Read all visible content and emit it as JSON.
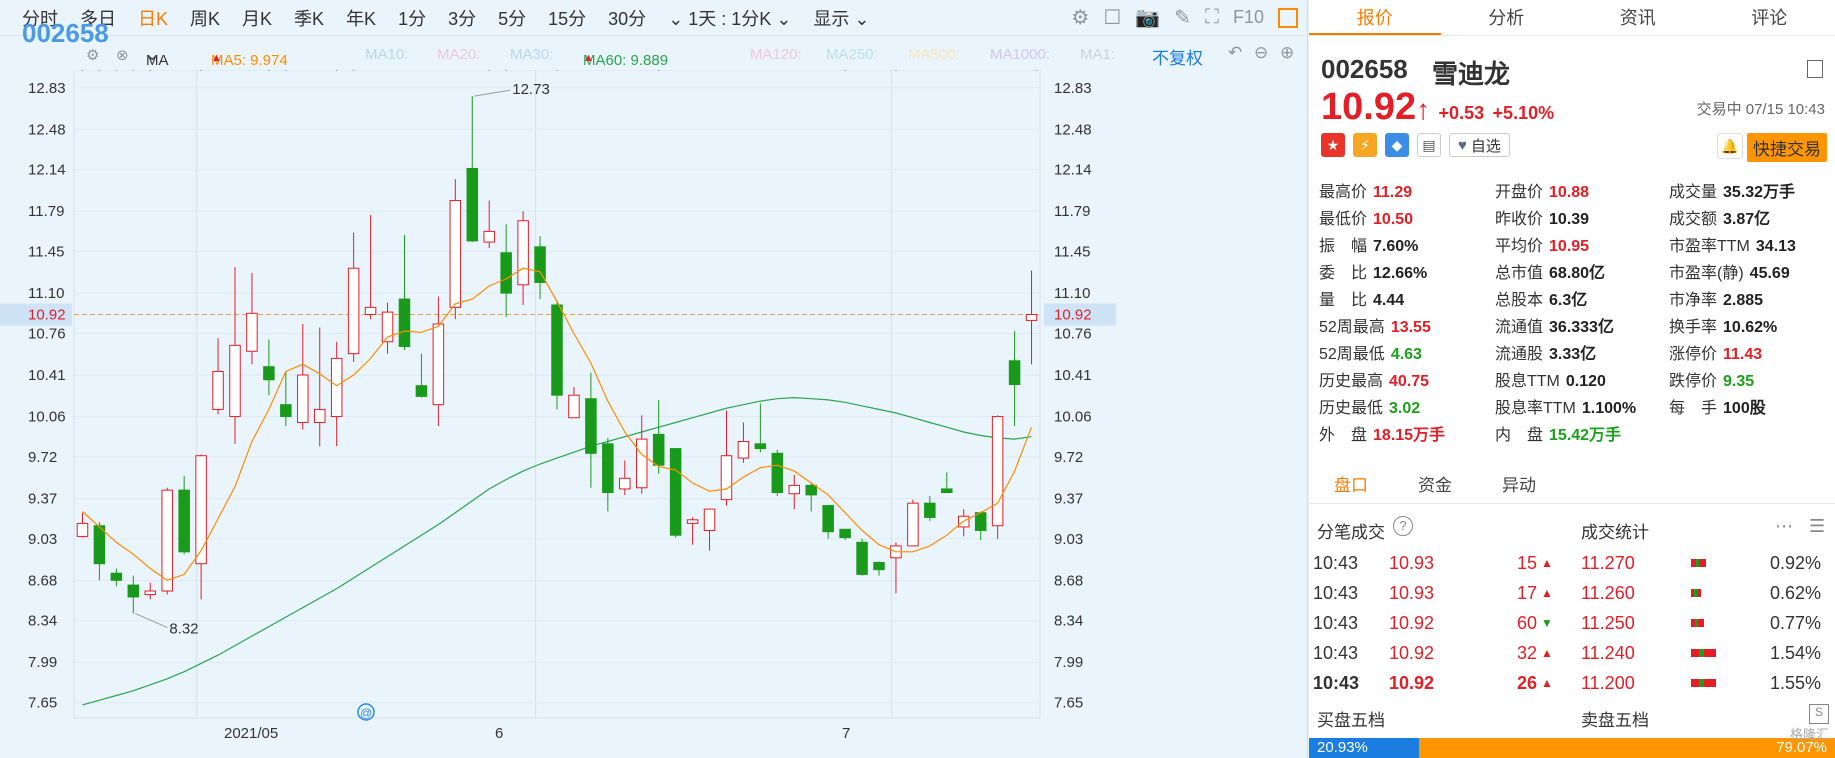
{
  "toolbar": {
    "code": "002658",
    "periods": [
      "分时",
      "多日",
      "日K",
      "周K",
      "月K",
      "季K",
      "年K",
      "1分",
      "3分",
      "5分",
      "15分",
      "30分"
    ],
    "active_period": "日K",
    "range_select": "1天 : 1分K",
    "display": "显示",
    "f10": "F10"
  },
  "ma_bar": {
    "label": "MA",
    "ma5": "MA5: 9.974",
    "ma10": "MA10:",
    "ma20": "MA20:",
    "ma30": "MA30:",
    "ma60": "MA60: 9.889",
    "ma120": "MA120:",
    "ma250": "MA250:",
    "ma500": "MA500:",
    "ma1000": "MA1000:",
    "ma1": "MA1:",
    "adjust": "不复权",
    "colors": {
      "ma5": "#ff8c00",
      "ma60": "#2aa54a",
      "faded": "#b9d7f0"
    }
  },
  "chart_data": {
    "type": "candlestick",
    "y_ticks": [
      "12.83",
      "12.48",
      "12.14",
      "11.79",
      "11.45",
      "11.10",
      "10.76",
      "10.41",
      "10.06",
      "9.72",
      "9.37",
      "9.03",
      "8.68",
      "8.34",
      "7.99",
      "7.65"
    ],
    "x_labels": [
      "2021/05",
      "6",
      "7"
    ],
    "current_price": "10.92",
    "high_annotation": "12.73",
    "low_annotation": "8.32",
    "candles": [
      [
        9.05,
        9.16,
        9.25,
        9.04
      ],
      [
        9.14,
        8.82,
        9.17,
        8.68
      ],
      [
        8.74,
        8.68,
        8.78,
        8.63
      ],
      [
        8.64,
        8.54,
        8.72,
        8.4
      ],
      [
        8.56,
        8.59,
        8.66,
        8.52
      ],
      [
        8.59,
        9.44,
        9.46,
        8.56
      ],
      [
        9.44,
        8.92,
        9.56,
        8.9
      ],
      [
        8.82,
        9.73,
        9.74,
        8.52
      ],
      [
        10.12,
        10.44,
        10.72,
        10.08
      ],
      [
        10.06,
        10.66,
        11.32,
        9.83
      ],
      [
        10.61,
        10.93,
        11.27,
        10.5
      ],
      [
        10.48,
        10.37,
        10.71,
        10.24
      ],
      [
        10.16,
        10.06,
        10.44,
        9.98
      ],
      [
        10.01,
        10.41,
        10.84,
        9.95
      ],
      [
        10.01,
        10.12,
        10.81,
        9.81
      ],
      [
        10.06,
        10.55,
        10.69,
        9.81
      ],
      [
        10.59,
        11.31,
        11.61,
        10.52
      ],
      [
        10.92,
        10.98,
        11.76,
        10.88
      ],
      [
        10.69,
        10.94,
        11.02,
        10.59
      ],
      [
        11.05,
        10.65,
        11.59,
        10.62
      ],
      [
        10.32,
        10.23,
        10.59,
        10.22
      ],
      [
        10.16,
        10.84,
        11.07,
        9.98
      ],
      [
        10.98,
        11.88,
        12.06,
        10.88
      ],
      [
        12.15,
        11.54,
        12.76,
        11.53
      ],
      [
        11.53,
        11.62,
        11.88,
        11.48
      ],
      [
        11.44,
        11.1,
        11.68,
        10.9
      ],
      [
        11.17,
        11.71,
        11.79,
        11.0
      ],
      [
        11.49,
        11.19,
        11.58,
        11.05
      ],
      [
        11.0,
        10.24,
        11.04,
        10.12
      ],
      [
        10.05,
        10.24,
        10.31,
        10.1
      ],
      [
        10.21,
        9.75,
        10.43,
        9.46
      ],
      [
        9.83,
        9.42,
        9.88,
        9.26
      ],
      [
        9.45,
        9.54,
        9.69,
        9.4
      ],
      [
        9.46,
        9.87,
        10.07,
        9.41
      ],
      [
        9.91,
        9.65,
        10.2,
        9.58
      ],
      [
        9.79,
        9.06,
        9.79,
        9.04
      ],
      [
        9.16,
        9.19,
        9.21,
        8.98
      ],
      [
        9.1,
        9.28,
        9.28,
        8.93
      ],
      [
        9.36,
        9.73,
        10.11,
        9.31
      ],
      [
        9.71,
        9.85,
        10.01,
        9.67
      ],
      [
        9.83,
        9.79,
        10.17,
        9.76
      ],
      [
        9.75,
        9.42,
        9.78,
        9.39
      ],
      [
        9.41,
        9.48,
        9.57,
        9.28
      ],
      [
        9.48,
        9.4,
        9.5,
        9.26
      ],
      [
        9.31,
        9.09,
        9.31,
        9.03
      ],
      [
        9.11,
        9.04,
        9.11,
        9.02
      ],
      [
        9.0,
        8.73,
        9.03,
        8.72
      ],
      [
        8.83,
        8.77,
        8.84,
        8.72
      ],
      [
        8.87,
        8.97,
        9.0,
        8.57
      ],
      [
        8.97,
        9.33,
        9.36,
        8.98
      ],
      [
        9.33,
        9.21,
        9.39,
        9.18
      ],
      [
        9.45,
        9.42,
        9.59,
        9.43
      ],
      [
        9.13,
        9.22,
        9.28,
        9.05
      ],
      [
        9.25,
        9.1,
        9.26,
        9.02
      ],
      [
        9.14,
        10.06,
        10.07,
        9.03
      ],
      [
        10.53,
        10.33,
        10.78,
        9.98
      ],
      [
        10.87,
        10.92,
        11.29,
        10.5
      ]
    ],
    "ma5_line": [
      9.26,
      9.13,
      9.0,
      8.9,
      8.78,
      8.68,
      8.73,
      8.93,
      9.2,
      9.47,
      9.85,
      10.12,
      10.44,
      10.5,
      10.42,
      10.32,
      10.41,
      10.55,
      10.73,
      10.78,
      10.77,
      10.82,
      11.01,
      11.05,
      11.16,
      11.22,
      11.31,
      11.28,
      11.03,
      10.76,
      10.51,
      10.19,
      9.93,
      9.74,
      9.64,
      9.61,
      9.5,
      9.43,
      9.45,
      9.55,
      9.63,
      9.65,
      9.6,
      9.5,
      9.4,
      9.25,
      9.1,
      8.98,
      8.92,
      8.92,
      8.97,
      9.06,
      9.18,
      9.25,
      9.33,
      9.6,
      9.97
    ],
    "ma60_line": [
      7.63,
      7.67,
      7.71,
      7.75,
      7.8,
      7.85,
      7.91,
      7.98,
      8.05,
      8.13,
      8.21,
      8.29,
      8.37,
      8.45,
      8.53,
      8.61,
      8.7,
      8.79,
      8.88,
      8.97,
      9.06,
      9.15,
      9.25,
      9.35,
      9.45,
      9.53,
      9.6,
      9.66,
      9.71,
      9.76,
      9.81,
      9.85,
      9.89,
      9.93,
      9.97,
      10.01,
      10.05,
      10.09,
      10.13,
      10.16,
      10.19,
      10.21,
      10.22,
      10.21,
      10.2,
      10.18,
      10.15,
      10.12,
      10.09,
      10.05,
      10.01,
      9.97,
      9.93,
      9.9,
      9.88,
      9.87,
      9.89
    ],
    "ylim": [
      7.52,
      12.98
    ]
  },
  "quote": {
    "tabs": [
      "报价",
      "分析",
      "资讯",
      "评论"
    ],
    "code": "002658",
    "name": "雪迪龙",
    "price": "10.92",
    "arrow": "↑",
    "change": "+0.53",
    "change_pct": "+5.10%",
    "status": "交易中 07/15 10:43",
    "watch_label": "自选",
    "quick_trade": "快捷交易",
    "grid": [
      [
        [
          "最高价",
          "11.29",
          "red"
        ],
        [
          "开盘价",
          "10.88",
          "red"
        ],
        [
          "成交量",
          "35.32万手",
          "dark"
        ]
      ],
      [
        [
          "最低价",
          "10.50",
          "red"
        ],
        [
          "昨收价",
          "10.39",
          "dark"
        ],
        [
          "成交额",
          "3.87亿",
          "dark"
        ]
      ],
      [
        [
          "振　幅",
          "7.60%",
          "dark"
        ],
        [
          "平均价",
          "10.95",
          "red"
        ],
        [
          "市盈率TTM",
          "34.13",
          "dark"
        ]
      ],
      [
        [
          "委　比",
          "12.66%",
          "dark"
        ],
        [
          "总市值",
          "68.80亿",
          "dark"
        ],
        [
          "市盈率(静)",
          "45.69",
          "dark"
        ]
      ],
      [
        [
          "量　比",
          "4.44",
          "dark"
        ],
        [
          "总股本",
          "6.3亿",
          "dark"
        ],
        [
          "市净率",
          "2.885",
          "dark"
        ]
      ],
      [
        [
          "52周最高",
          "13.55",
          "red"
        ],
        [
          "流通值",
          "36.333亿",
          "dark"
        ],
        [
          "换手率",
          "10.62%",
          "dark"
        ]
      ],
      [
        [
          "52周最低",
          "4.63",
          "green"
        ],
        [
          "流通股",
          "3.33亿",
          "dark"
        ],
        [
          "涨停价",
          "11.43",
          "red"
        ]
      ],
      [
        [
          "历史最高",
          "40.75",
          "red"
        ],
        [
          "股息TTM",
          "0.120",
          "dark"
        ],
        [
          "跌停价",
          "9.35",
          "green"
        ]
      ],
      [
        [
          "历史最低",
          "3.02",
          "green"
        ],
        [
          "股息率TTM",
          "1.100%",
          "dark"
        ],
        [
          "每　手",
          "100股",
          "dark"
        ]
      ],
      [
        [
          "外　盘",
          "18.15万手",
          "red"
        ],
        [
          "内　盘",
          "15.42万手",
          "green"
        ],
        [
          "",
          "",
          "dark"
        ]
      ]
    ]
  },
  "subtabs": [
    "盘口",
    "资金",
    "异动"
  ],
  "ticks_title": "分笔成交",
  "stats_title": "成交统计",
  "ticks": [
    {
      "time": "10:43",
      "price": "10.93",
      "vol": "15",
      "dir": "up"
    },
    {
      "time": "10:43",
      "price": "10.93",
      "vol": "17",
      "dir": "up"
    },
    {
      "time": "10:43",
      "price": "10.92",
      "vol": "60",
      "dir": "down"
    },
    {
      "time": "10:43",
      "price": "10.92",
      "vol": "32",
      "dir": "up"
    },
    {
      "time": "10:43",
      "price": "10.92",
      "vol": "26",
      "dir": "up"
    }
  ],
  "stats": [
    {
      "price": "11.270",
      "pct": "0.92%"
    },
    {
      "price": "11.260",
      "pct": "0.62%"
    },
    {
      "price": "11.250",
      "pct": "0.77%"
    },
    {
      "price": "11.240",
      "pct": "1.54%"
    },
    {
      "price": "11.200",
      "pct": "1.55%"
    }
  ],
  "book": {
    "buy_title": "买盘五档",
    "sell_title": "卖盘五档",
    "buy_pct": "20.93%",
    "sell_pct": "79.07%"
  },
  "watermark": "格隆汇"
}
